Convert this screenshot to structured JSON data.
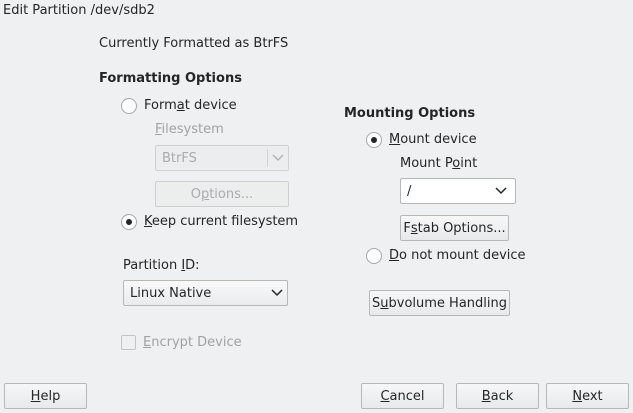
{
  "window": {
    "title": "Edit Partition /dev/sdb2"
  },
  "status": {
    "text": "Currently Formatted as BtrFS"
  },
  "formatting": {
    "heading": "Formatting Options",
    "format_device": {
      "pre": "Form",
      "u": "a",
      "post": "t device"
    },
    "filesystem_label": {
      "u": "F",
      "post": "ilesystem"
    },
    "filesystem_value": "BtrFS",
    "options_button": {
      "pre": "O",
      "u": "p",
      "post": "tions..."
    },
    "keep_current": {
      "u": "K",
      "post": "eep current filesystem"
    },
    "partition_id_label": {
      "pre": "Partition ",
      "u": "I",
      "post": "D:"
    },
    "partition_id_value": "Linux Native",
    "encrypt": {
      "u": "E",
      "post": "ncrypt Device"
    }
  },
  "mounting": {
    "heading": "Mounting Options",
    "mount_device": {
      "u": "M",
      "post": "ount device"
    },
    "mount_point_label": {
      "pre": "Mount P",
      "u": "o",
      "post": "int"
    },
    "mount_point_value": "/",
    "fstab_button": {
      "pre": "F",
      "u": "s",
      "post": "tab Options..."
    },
    "do_not_mount": {
      "u": "D",
      "post": "o not mount device"
    },
    "subvolume_button": {
      "pre": "S",
      "u": "u",
      "post": "bvolume Handling"
    }
  },
  "footer": {
    "help": {
      "u": "H",
      "post": "elp"
    },
    "cancel": {
      "u": "C",
      "post": "ancel"
    },
    "back": {
      "u": "B",
      "post": "ack"
    },
    "next": {
      "u": "N",
      "post": "ext"
    }
  }
}
